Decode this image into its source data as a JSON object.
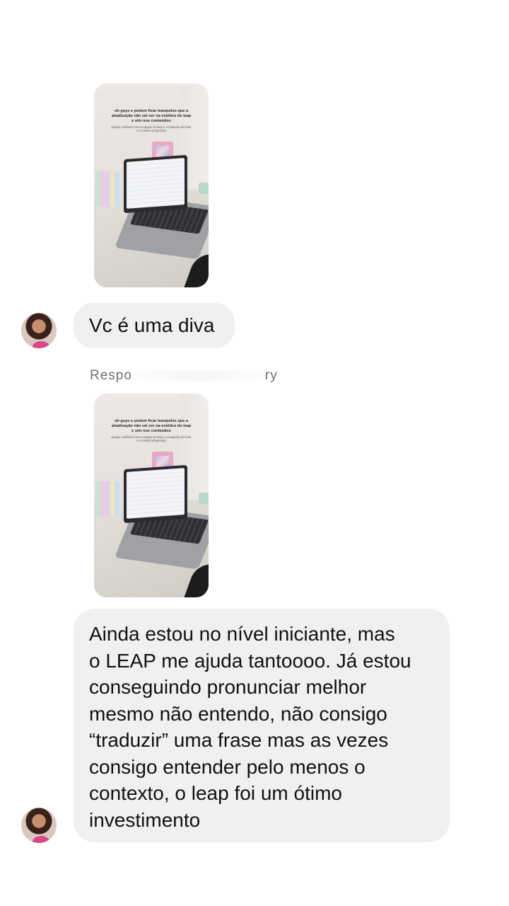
{
  "thread": {
    "stories": [
      {
        "overlay_title": "oh guys e podem ficar tranquilos que a atualização não vai ser na estética do leap e sim nos conteúdos",
        "overlay_subtitle": "porque confirmei com a equipe do leap e a maquina de fonte e o mesmo teleprompt"
      },
      {
        "overlay_title": "oh guys e podem ficar tranquilos que a atualização não vai ser na estética do leap e sim nos conteúdos",
        "overlay_subtitle": "porque confirmei com a equipe do leap e a maquina de fonte e o mesmo teleprompt"
      }
    ],
    "messages": [
      {
        "text": "Vc é uma diva"
      },
      {
        "lines": [
          "Ainda estou no nível iniciante, mas",
          "o LEAP me ajuda tantoooo. Já estou",
          "conseguindo pronunciar melhor",
          "mesmo não entendo, não consigo",
          "“traduzir” uma frase mas as vezes",
          "consigo entender pelo menos o",
          "contexto, o leap foi um ótimo",
          "investimento"
        ]
      }
    ],
    "reply_label_start": "Respo",
    "reply_label_end": "ry"
  },
  "colors": {
    "bubble": "#eff0f2",
    "text": "#111111",
    "secondary_text": "#6e6f73",
    "background": "#ffffff"
  }
}
